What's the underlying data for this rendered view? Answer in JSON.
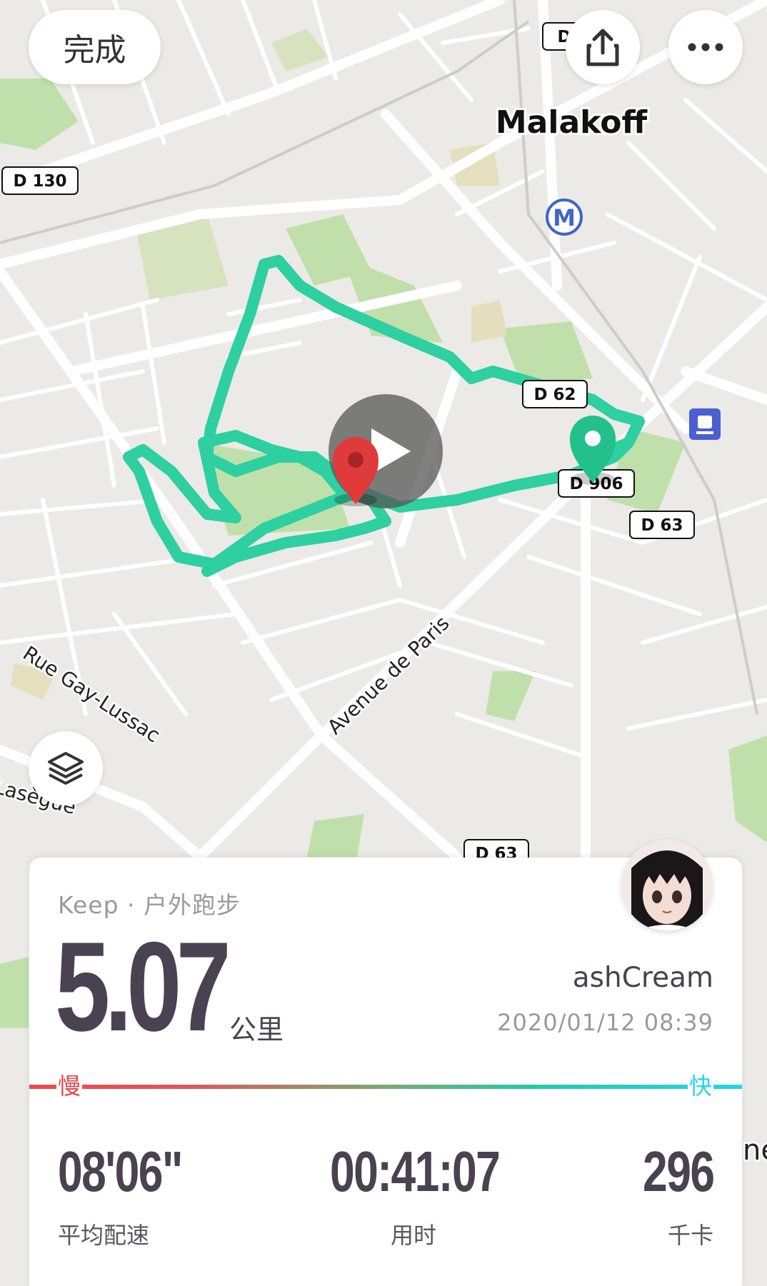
{
  "toolbar": {
    "done_label": "完成"
  },
  "map": {
    "city_label": "Malakoff",
    "metro_label": "M",
    "street_labels": [
      "Rue Gay-Lussac",
      "Avenue de Paris",
      "Lasègue",
      "ne"
    ],
    "road_badges": [
      "D 130",
      "D 63",
      "D 63",
      "D 906",
      "D 62",
      "D"
    ],
    "colors": {
      "route": "#2ecfa0",
      "end_marker": "#e03b3b",
      "start_marker": "#22c08a"
    }
  },
  "activity": {
    "source": "Keep · 户外跑步",
    "distance": "5.07",
    "distance_unit": "公里",
    "username": "ashCream",
    "datetime": "2020/01/12 08:39",
    "pace_slow_label": "慢",
    "pace_fast_label": "快",
    "stats": {
      "pace_value": "08'06\"",
      "pace_label": "平均配速",
      "time_value": "00:41:07",
      "time_label": "用时",
      "calories_value": "296",
      "calories_label": "千卡"
    }
  }
}
